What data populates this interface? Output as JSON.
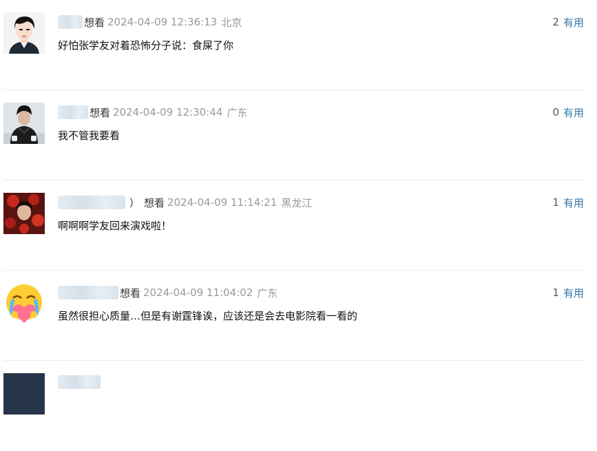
{
  "comments": [
    {
      "name_suffix": "",
      "status": "想看",
      "time": "2024-04-09 12:36:13",
      "location": "北京",
      "vote_count": "2",
      "vote_label": "有用",
      "content": "好怕张学友对着恐怖分子说：食屎了你",
      "avatar_icon": "cartoon-boy-avatar"
    },
    {
      "name_suffix": "",
      "status": "想看",
      "time": "2024-04-09 12:30:44",
      "location": "广东",
      "vote_count": "0",
      "vote_label": "有用",
      "content": "我不管我要看",
      "avatar_icon": "winter-person-avatar"
    },
    {
      "name_suffix": "）",
      "status": "想看",
      "time": "2024-04-09 11:14:21",
      "location": "黑龙江",
      "vote_count": "1",
      "vote_label": "有用",
      "content": "啊啊啊学友回来演戏啦！",
      "avatar_icon": "red-flowers-avatar"
    },
    {
      "name_suffix": "",
      "status": "想看",
      "time": "2024-04-09 11:04:02",
      "location": "广东",
      "vote_count": "1",
      "vote_label": "有用",
      "content": "虽然很担心质量…但是有谢霆锋诶，应该还是会去电影院看一看的",
      "avatar_icon": "crying-heart-emoji-avatar"
    }
  ]
}
